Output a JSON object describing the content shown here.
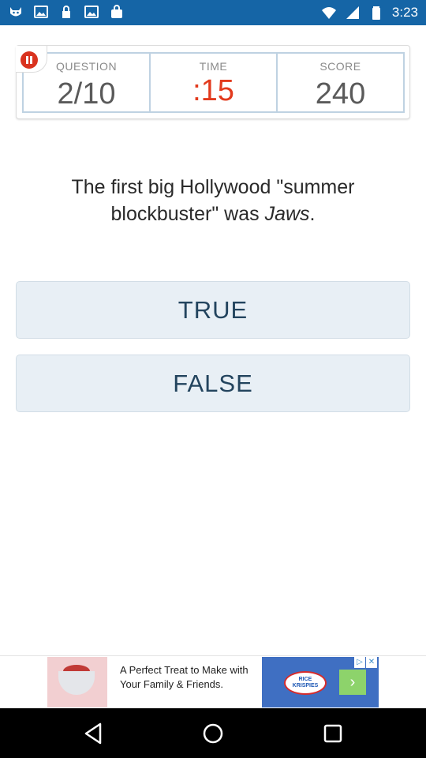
{
  "status_bar": {
    "time": "3:23",
    "left_icons": [
      "cat-app-icon",
      "photo-icon",
      "lock-icon",
      "photo-icon",
      "bag-icon"
    ],
    "right_icons": [
      "wifi-icon",
      "signal-icon",
      "battery-icon"
    ],
    "background": "#1565a6"
  },
  "scoreboard": {
    "question_label": "QUESTION",
    "question_value": "2/10",
    "time_label": "TIME",
    "time_value": ":15",
    "score_label": "SCORE",
    "score_value": "240",
    "time_color": "#e23a1d",
    "pause_icon": "pause-icon"
  },
  "question": {
    "text_before": "The first big Hollywood \"summer blockbuster\" was ",
    "text_italic": "Jaws",
    "text_after": "."
  },
  "answers": {
    "true_label": "TRUE",
    "false_label": "FALSE"
  },
  "ad": {
    "text": "A Perfect Treat to Make with Your Family & Friends.",
    "brand": "RICE KRISPIES",
    "arrow_icon": "chevron-right-icon",
    "close_icons": [
      "ad-info-icon",
      "close-icon"
    ]
  },
  "nav_bar": {
    "buttons": [
      "back-icon",
      "home-icon",
      "recent-apps-icon"
    ]
  }
}
